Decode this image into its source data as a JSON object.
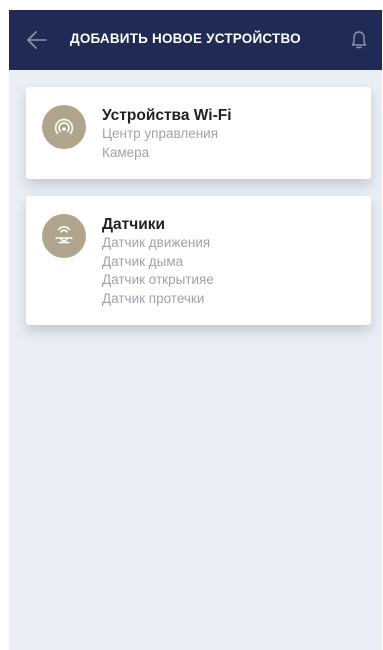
{
  "header": {
    "title": "ДОБАВИТЬ НОВОЕ УСТРОЙСТВО",
    "back_icon": "arrow-left-icon",
    "bell_icon": "bell-icon",
    "background": "#1f2b54"
  },
  "categories": [
    {
      "icon": "wifi-signal-icon",
      "title": "Устройства Wi-Fi",
      "items": [
        "Центр управления",
        "Камера"
      ]
    },
    {
      "icon": "sensor-icon",
      "title": "Датчики",
      "items": [
        "Датчик движения",
        "Датчик дыма",
        "Датчик открытияе",
        "Датчик протечки"
      ]
    }
  ],
  "colors": {
    "icon_circle": "#b1a48d",
    "page_background": "#e9eff5",
    "subtitle_text": "#9ea4ab"
  }
}
